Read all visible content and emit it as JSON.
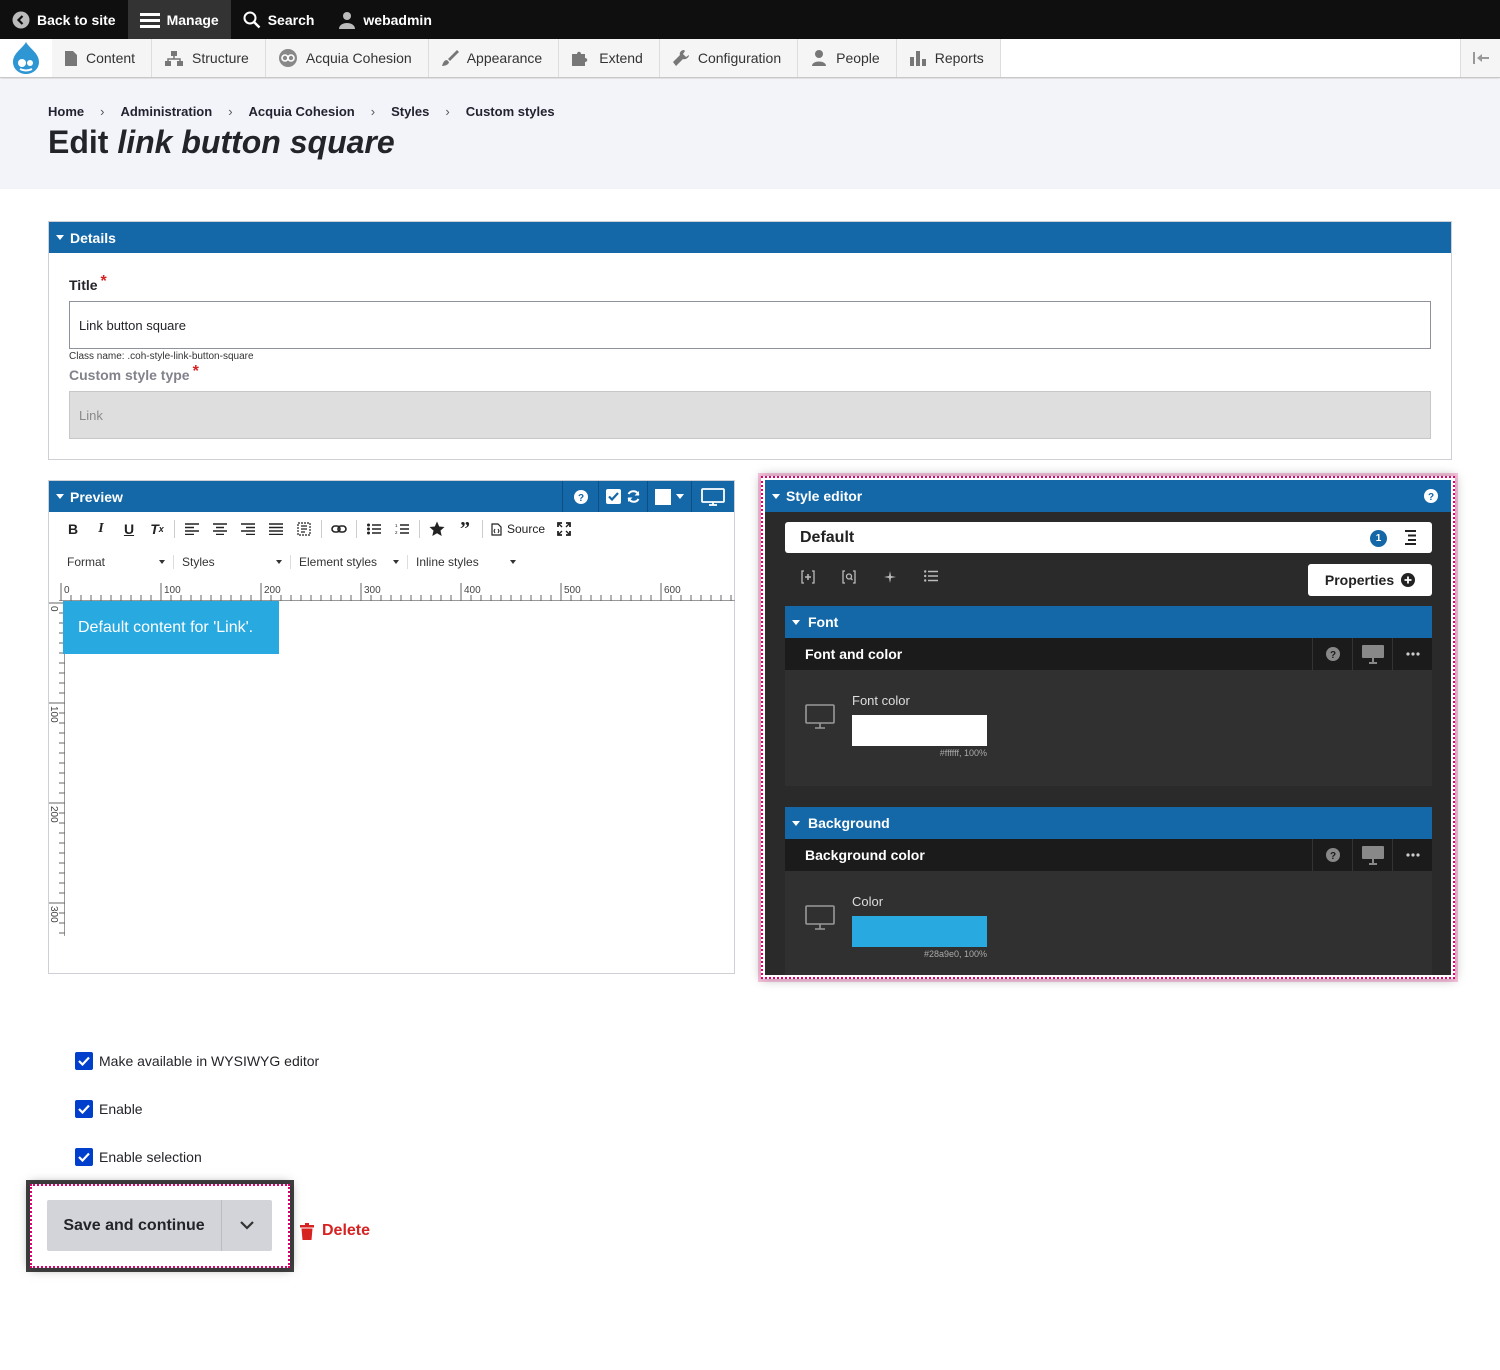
{
  "toolbar": {
    "back_to_site": "Back to site",
    "manage": "Manage",
    "search": "Search",
    "user": "webadmin"
  },
  "tray": {
    "items": [
      "Content",
      "Structure",
      "Acquia Cohesion",
      "Appearance",
      "Extend",
      "Configuration",
      "People",
      "Reports"
    ]
  },
  "breadcrumb": [
    "Home",
    "Administration",
    "Acquia Cohesion",
    "Styles",
    "Custom styles"
  ],
  "page": {
    "title_prefix": "Edit ",
    "title_name": "link button square"
  },
  "details": {
    "heading": "Details",
    "title_label": "Title",
    "title_value": "Link button square",
    "class_name": "Class name: .coh-style-link-button-square",
    "type_label": "Custom style type",
    "type_value": "Link"
  },
  "preview": {
    "heading": "Preview",
    "source_label": "Source",
    "combos": [
      "Format",
      "Styles",
      "Element styles",
      "Inline styles"
    ],
    "ruler_h": [
      "0",
      "100",
      "200",
      "300",
      "400",
      "500",
      "600"
    ],
    "ruler_v": [
      "0",
      "100",
      "200",
      "300"
    ],
    "content": "Default content for 'Link'."
  },
  "style_editor": {
    "heading": "Style editor",
    "default_label": "Default",
    "badge": "1",
    "properties_label": "Properties",
    "font_section": "Font",
    "font_group": "Font and color",
    "font_color_label": "Font color",
    "font_color_value": "#ffffff, 100%",
    "font_color_hex": "#ffffff",
    "bg_section": "Background",
    "bg_group": "Background color",
    "bg_color_label": "Color",
    "bg_color_value": "#28a9e0, 100%",
    "bg_color_hex": "#28a9e0"
  },
  "options": {
    "wysiwyg": "Make available in WYSIWYG editor",
    "enable": "Enable",
    "enable_selection": "Enable selection"
  },
  "actions": {
    "save": "Save and continue",
    "delete": "Delete"
  },
  "colors": {
    "accent": "#1468a7",
    "checkbox": "#003ecc",
    "delete": "#d72222",
    "highlight": "#e0006f"
  }
}
